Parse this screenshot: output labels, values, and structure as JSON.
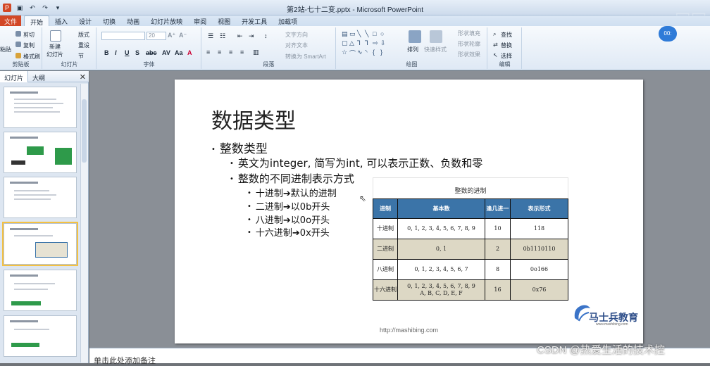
{
  "window": {
    "title": "第2站-七十二变.pptx - Microsoft PowerPoint"
  },
  "menu": {
    "tabs": [
      "文件",
      "开始",
      "插入",
      "设计",
      "切换",
      "动画",
      "幻灯片放映",
      "审阅",
      "视图",
      "开发工具",
      "加载项"
    ]
  },
  "ribbon": {
    "clipboard": {
      "group": "剪贴板",
      "paste": "粘贴",
      "cut": "剪切",
      "copy": "复制",
      "format_painter": "格式刷"
    },
    "slides": {
      "group": "幻灯片",
      "new_slide": "新建\n幻灯片",
      "layout": "版式",
      "reset": "重设",
      "section": "节"
    },
    "font": {
      "group": "字体",
      "size": "20"
    },
    "paragraph": {
      "group": "段落",
      "text_direction": "文字方向",
      "align_text": "对齐文本",
      "smartart": "转换为 SmartArt"
    },
    "drawing": {
      "group": "绘图",
      "arrange": "排列",
      "quick_styles": "快速样式",
      "shape_fill": "形状填充",
      "shape_outline": "形状轮廓",
      "shape_effects": "形状效果"
    },
    "editing": {
      "group": "编辑",
      "find": "查找",
      "replace": "替换",
      "select": "选择"
    }
  },
  "left_pane": {
    "tabs": [
      "幻灯片",
      "大纲"
    ]
  },
  "slide": {
    "title": "数据类型",
    "bullets": {
      "b1": "整数类型",
      "b2": "英文为integer, 简写为int, 可以表示正数、负数和零",
      "b3": "整数的不同进制表示方式",
      "b4": "十进制➔默认的进制",
      "b5": "二进制➔以0b开头",
      "b6": "八进制➔以0o开头",
      "b7": "十六进制➔0x开头"
    },
    "table": {
      "caption": "整数的进制",
      "headers": [
        "进制",
        "基本数",
        "逢几进一",
        "表示形式"
      ],
      "rows": [
        [
          "十进制",
          "0, 1, 2, 3, 4, 5, 6, 7, 8, 9",
          "10",
          "118"
        ],
        [
          "二进制",
          "0, 1",
          "2",
          "0b1110110"
        ],
        [
          "八进制",
          "0, 1, 2, 3, 4, 5, 6, 7",
          "8",
          "0o166"
        ],
        [
          "十六进制",
          "0, 1, 2, 3, 4, 5, 6, 7, 8, 9\nA, B, C, D, E, F",
          "16",
          "0x76"
        ]
      ]
    },
    "logo_text": "马士兵教育",
    "logo_url": "www.mashibing.com",
    "url": "http://mashibing.com"
  },
  "notes": {
    "placeholder": "单击此处添加备注"
  },
  "overlay": {
    "watermark": "CSDN @热爱生活的技术控",
    "timer": "00:"
  },
  "colors": {
    "file_tab": "#d24726",
    "table_header": "#3b74a8",
    "table_shade": "#ddd8c5",
    "selection": "#f4c142"
  }
}
